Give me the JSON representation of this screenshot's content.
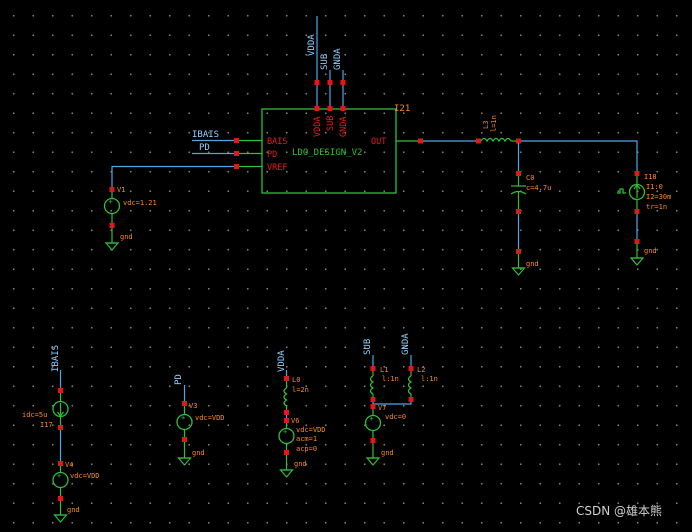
{
  "main_block": {
    "instance": "I21",
    "cell": "LDO_DESIGN_V2",
    "pins_left": [
      "BAIS",
      "PD",
      "VREF"
    ],
    "pins_top": [
      "VDDA",
      "SUB",
      "GNDA"
    ],
    "pin_right": "OUT"
  },
  "nets": {
    "ibais": "IBAIS",
    "pd": "PD",
    "vdda": "VDDA",
    "sub": "SUB",
    "gnda": "GNDA"
  },
  "v1": {
    "name": "V1",
    "param": "vdc=1.21",
    "gnd": "gnd"
  },
  "l3": {
    "name": "L3",
    "param": "l=1n"
  },
  "c0": {
    "name": "C0",
    "param": "c=4.7u",
    "gnd": "gnd"
  },
  "i18": {
    "name": "I18",
    "params": [
      "I1:0",
      "I2=30m",
      "tr=1n"
    ],
    "gnd": "gnd"
  },
  "i17": {
    "name": "I17",
    "param": "idc=5u"
  },
  "v4": {
    "name": "V4",
    "param": "vdc=VDD",
    "gnd": "gnd"
  },
  "v3": {
    "name": "V3",
    "param": "vdc=VDD",
    "gnd": "gnd"
  },
  "l0": {
    "name": "L0",
    "param": "l=2n"
  },
  "v6": {
    "name": "V6",
    "params": [
      "vdc=VDD",
      "acm=1",
      "acp=0"
    ],
    "gnd": "gnd"
  },
  "l1": {
    "name": "L1",
    "param": "l:1n"
  },
  "l2": {
    "name": "L2",
    "param": "l:1n"
  },
  "v7": {
    "name": "V7",
    "param": "vdc=0",
    "gnd": "gnd"
  },
  "watermark": "CSDN @雄本熊"
}
